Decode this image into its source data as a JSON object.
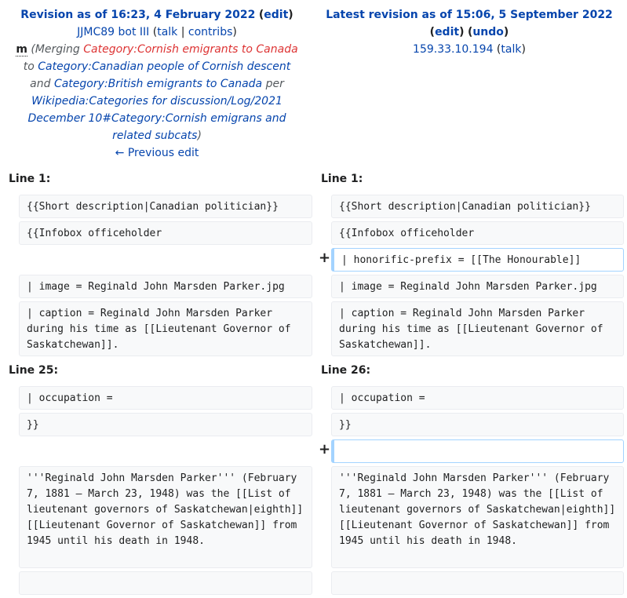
{
  "left_header": {
    "title_prefix": "Revision as of 16:23, 4 February 2022",
    "edit": "edit",
    "user": "JJMC89 bot III",
    "talk": "talk",
    "contribs": "contribs",
    "minor": "m",
    "summary": {
      "merging": "(Merging ",
      "cat1": "Category:Cornish emigrants to Canada",
      "to": " to ",
      "cat2": "Category:Canadian people of Cornish descent",
      "and": " and ",
      "cat3": "Category:British emigrants to Canada",
      "per": " per ",
      "cfd": "Wikipedia:Categories for discussion/Log/2021 December 10#Category:Cornish emigrans and related subcats",
      "close": ")"
    },
    "prev": "← Previous edit"
  },
  "right_header": {
    "title": "Latest revision as of 15:06, 5 September 2022",
    "edit": "edit",
    "undo": "undo",
    "user": "159.33.10.194",
    "talk": "talk"
  },
  "diff": {
    "line1_left": "Line 1:",
    "line1_right": "Line 1:",
    "line25_left": "Line 25:",
    "line26_right": "Line 26:",
    "plus": "+",
    "short_desc": "{{Short description|Canadian politician}}",
    "infobox": "{{Infobox officeholder",
    "honorific": "| honorific-prefix = [[The Honourable]]",
    "image": "| image = Reginald John Marsden Parker.jpg",
    "caption": "| caption = Reginald John Marsden Parker during his time as [[Lieutenant Governor of Saskatchewan]].",
    "occupation": "| occupation =",
    "close_braces": "}}",
    "lead": "'''Reginald John Marsden Parker''' (February 7, 1881 – March 23, 1948) was the [[List of lieutenant governors of Saskatchewan|eighth]] [[Lieutenant Governor of Saskatchewan]] from 1945 until his death in 1948."
  }
}
